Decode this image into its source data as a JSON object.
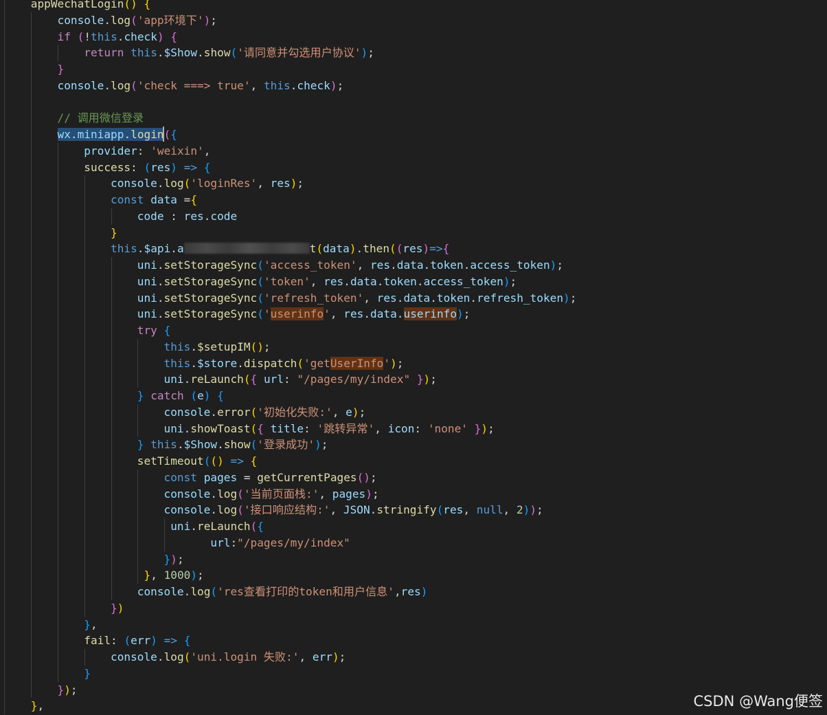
{
  "theme": {
    "background": "#1f1f1f",
    "colors": {
      "d": "#d4d4d4",
      "k": "#569cd6",
      "c": "#c586c0",
      "f": "#dcdcaa",
      "v": "#9cdcfe",
      "s": "#ce9178",
      "n": "#b5cea8",
      "m": "#6a9955",
      "y": "#ffd700",
      "p": "#da70d6",
      "b": "#179fff",
      "selection": "#264f78",
      "word_highlight": "#613214"
    }
  },
  "watermark": "CSDN @Wang便签",
  "code_lines": [
    [
      [
        "f",
        "appWechatLogin"
      ],
      [
        "y",
        "() {"
      ]
    ],
    [
      [
        "v",
        "console"
      ],
      [
        "d",
        "."
      ],
      [
        "f",
        "log"
      ],
      [
        "p",
        "("
      ],
      [
        "s",
        "'app环境下'"
      ],
      [
        "p",
        ")"
      ],
      [
        "d",
        ";"
      ]
    ],
    [
      [
        "c",
        "if"
      ],
      [
        "d",
        " "
      ],
      [
        "p",
        "("
      ],
      [
        "d",
        "!"
      ],
      [
        "k",
        "this"
      ],
      [
        "d",
        "."
      ],
      [
        "v",
        "check"
      ],
      [
        "p",
        ")"
      ],
      [
        "d",
        " "
      ],
      [
        "p",
        "{"
      ]
    ],
    [
      [
        "c",
        "return"
      ],
      [
        "d",
        " "
      ],
      [
        "k",
        "this"
      ],
      [
        "d",
        "."
      ],
      [
        "v",
        "$Show"
      ],
      [
        "d",
        "."
      ],
      [
        "f",
        "show"
      ],
      [
        "b",
        "("
      ],
      [
        "s",
        "'请同意并勾选用户协议'"
      ],
      [
        "b",
        ")"
      ],
      [
        "d",
        ";"
      ]
    ],
    [
      [
        "p",
        "}"
      ]
    ],
    [
      [
        "v",
        "console"
      ],
      [
        "d",
        "."
      ],
      [
        "f",
        "log"
      ],
      [
        "p",
        "("
      ],
      [
        "s",
        "'check ===> true'"
      ],
      [
        "d",
        ", "
      ],
      [
        "k",
        "this"
      ],
      [
        "d",
        "."
      ],
      [
        "v",
        "check"
      ],
      [
        "p",
        ")"
      ],
      [
        "d",
        ";"
      ]
    ],
    [],
    [
      [
        "m",
        "// 调用微信登录"
      ]
    ],
    [
      [
        "v",
        "wx",
        "sel"
      ],
      [
        "d",
        ".",
        "sel"
      ],
      [
        "v",
        "miniapp",
        "sel"
      ],
      [
        "d",
        ".",
        "sel"
      ],
      [
        "f",
        "login",
        "sel"
      ],
      [
        "p",
        "("
      ],
      [
        "b",
        "{"
      ]
    ],
    [
      [
        "v",
        "provider"
      ],
      [
        "d",
        ": "
      ],
      [
        "s",
        "'weixin'"
      ],
      [
        "d",
        ","
      ]
    ],
    [
      [
        "f",
        "success"
      ],
      [
        "d",
        ": "
      ],
      [
        "b",
        "("
      ],
      [
        "v",
        "res"
      ],
      [
        "b",
        ")"
      ],
      [
        "d",
        " "
      ],
      [
        "k",
        "=>"
      ],
      [
        "d",
        " "
      ],
      [
        "b",
        "{"
      ]
    ],
    [
      [
        "v",
        "console"
      ],
      [
        "d",
        "."
      ],
      [
        "f",
        "log"
      ],
      [
        "y",
        "("
      ],
      [
        "s",
        "'loginRes'"
      ],
      [
        "d",
        ", "
      ],
      [
        "v",
        "res"
      ],
      [
        "y",
        ")"
      ],
      [
        "d",
        ";"
      ]
    ],
    [
      [
        "k",
        "const"
      ],
      [
        "d",
        " "
      ],
      [
        "v",
        "data"
      ],
      [
        "d",
        " ="
      ],
      [
        "y",
        "{"
      ]
    ],
    [
      [
        "v",
        "code"
      ],
      [
        "d",
        " : "
      ],
      [
        "v",
        "res"
      ],
      [
        "d",
        "."
      ],
      [
        "v",
        "code"
      ]
    ],
    [
      [
        "y",
        "}"
      ]
    ],
    [
      [
        "k",
        "this"
      ],
      [
        "d",
        "."
      ],
      [
        "v",
        "$api"
      ],
      [
        "d",
        "."
      ],
      [
        "v",
        "a"
      ],
      [
        "blur",
        ""
      ],
      [
        "f",
        "t"
      ],
      [
        "y",
        "("
      ],
      [
        "v",
        "data"
      ],
      [
        "y",
        ")"
      ],
      [
        "d",
        "."
      ],
      [
        "f",
        "then"
      ],
      [
        "y",
        "("
      ],
      [
        "p",
        "("
      ],
      [
        "v",
        "res"
      ],
      [
        "p",
        ")"
      ],
      [
        "k",
        "=>"
      ],
      [
        "p",
        "{"
      ]
    ],
    [
      [
        "v",
        "uni"
      ],
      [
        "d",
        "."
      ],
      [
        "f",
        "setStorageSync"
      ],
      [
        "b",
        "("
      ],
      [
        "s",
        "'access_token'"
      ],
      [
        "d",
        ", "
      ],
      [
        "v",
        "res"
      ],
      [
        "d",
        "."
      ],
      [
        "v",
        "data"
      ],
      [
        "d",
        "."
      ],
      [
        "v",
        "token"
      ],
      [
        "d",
        "."
      ],
      [
        "v",
        "access_token"
      ],
      [
        "b",
        ")"
      ],
      [
        "d",
        ";"
      ]
    ],
    [
      [
        "v",
        "uni"
      ],
      [
        "d",
        "."
      ],
      [
        "f",
        "setStorageSync"
      ],
      [
        "b",
        "("
      ],
      [
        "s",
        "'token'"
      ],
      [
        "d",
        ", "
      ],
      [
        "v",
        "res"
      ],
      [
        "d",
        "."
      ],
      [
        "v",
        "data"
      ],
      [
        "d",
        "."
      ],
      [
        "v",
        "token"
      ],
      [
        "d",
        "."
      ],
      [
        "v",
        "access_token"
      ],
      [
        "b",
        ")"
      ],
      [
        "d",
        ";"
      ]
    ],
    [
      [
        "v",
        "uni"
      ],
      [
        "d",
        "."
      ],
      [
        "f",
        "setStorageSync"
      ],
      [
        "b",
        "("
      ],
      [
        "s",
        "'refresh_token'"
      ],
      [
        "d",
        ", "
      ],
      [
        "v",
        "res"
      ],
      [
        "d",
        "."
      ],
      [
        "v",
        "data"
      ],
      [
        "d",
        "."
      ],
      [
        "v",
        "token"
      ],
      [
        "d",
        "."
      ],
      [
        "v",
        "refresh_token"
      ],
      [
        "b",
        ")"
      ],
      [
        "d",
        ";"
      ]
    ],
    [
      [
        "v",
        "uni"
      ],
      [
        "d",
        "."
      ],
      [
        "f",
        "setStorageSync"
      ],
      [
        "b",
        "("
      ],
      [
        "s",
        "'"
      ],
      [
        "s",
        "userinfo",
        "hl"
      ],
      [
        "s",
        "'"
      ],
      [
        "d",
        ", "
      ],
      [
        "v",
        "res"
      ],
      [
        "d",
        "."
      ],
      [
        "v",
        "data"
      ],
      [
        "d",
        "."
      ],
      [
        "v",
        "userinfo",
        "hl"
      ],
      [
        "b",
        ")"
      ],
      [
        "d",
        ";"
      ]
    ],
    [
      [
        "c",
        "try"
      ],
      [
        "d",
        " "
      ],
      [
        "b",
        "{"
      ]
    ],
    [
      [
        "k",
        "this"
      ],
      [
        "d",
        "."
      ],
      [
        "f",
        "$setupIM"
      ],
      [
        "y",
        "()"
      ],
      [
        "d",
        ";"
      ]
    ],
    [
      [
        "k",
        "this"
      ],
      [
        "d",
        "."
      ],
      [
        "v",
        "$store"
      ],
      [
        "d",
        "."
      ],
      [
        "f",
        "dispatch"
      ],
      [
        "y",
        "("
      ],
      [
        "s",
        "'get"
      ],
      [
        "s",
        "UserInfo",
        "hl"
      ],
      [
        "s",
        "'"
      ],
      [
        "y",
        ")"
      ],
      [
        "d",
        ";"
      ]
    ],
    [
      [
        "v",
        "uni"
      ],
      [
        "d",
        "."
      ],
      [
        "f",
        "reLaunch"
      ],
      [
        "y",
        "("
      ],
      [
        "p",
        "{"
      ],
      [
        "d",
        " "
      ],
      [
        "v",
        "url"
      ],
      [
        "d",
        ": "
      ],
      [
        "s",
        "\"/pages/my/index\""
      ],
      [
        "d",
        " "
      ],
      [
        "p",
        "}"
      ],
      [
        "y",
        ")"
      ],
      [
        "d",
        ";"
      ]
    ],
    [
      [
        "b",
        "}"
      ],
      [
        "d",
        " "
      ],
      [
        "c",
        "catch"
      ],
      [
        "d",
        " "
      ],
      [
        "b",
        "("
      ],
      [
        "v",
        "e"
      ],
      [
        "b",
        ")"
      ],
      [
        "d",
        " "
      ],
      [
        "b",
        "{"
      ]
    ],
    [
      [
        "v",
        "console"
      ],
      [
        "d",
        "."
      ],
      [
        "f",
        "error"
      ],
      [
        "y",
        "("
      ],
      [
        "s",
        "'初始化失败:'"
      ],
      [
        "d",
        ", "
      ],
      [
        "v",
        "e"
      ],
      [
        "y",
        ")"
      ],
      [
        "d",
        ";"
      ]
    ],
    [
      [
        "v",
        "uni"
      ],
      [
        "d",
        "."
      ],
      [
        "f",
        "showToast"
      ],
      [
        "y",
        "("
      ],
      [
        "p",
        "{"
      ],
      [
        "d",
        " "
      ],
      [
        "v",
        "title"
      ],
      [
        "d",
        ": "
      ],
      [
        "s",
        "'跳转异常'"
      ],
      [
        "d",
        ", "
      ],
      [
        "v",
        "icon"
      ],
      [
        "d",
        ": "
      ],
      [
        "s",
        "'none'"
      ],
      [
        "d",
        " "
      ],
      [
        "p",
        "}"
      ],
      [
        "y",
        ")"
      ],
      [
        "d",
        ";"
      ]
    ],
    [
      [
        "b",
        "}"
      ],
      [
        "d",
        " "
      ],
      [
        "k",
        "this"
      ],
      [
        "d",
        "."
      ],
      [
        "v",
        "$Show"
      ],
      [
        "d",
        "."
      ],
      [
        "f",
        "show"
      ],
      [
        "b",
        "("
      ],
      [
        "s",
        "'登录成功'"
      ],
      [
        "b",
        ")"
      ],
      [
        "d",
        ";"
      ]
    ],
    [
      [
        "f",
        "setTimeout"
      ],
      [
        "b",
        "("
      ],
      [
        "y",
        "()"
      ],
      [
        "d",
        " "
      ],
      [
        "k",
        "=>"
      ],
      [
        "d",
        " "
      ],
      [
        "y",
        "{"
      ]
    ],
    [
      [
        "k",
        "const"
      ],
      [
        "d",
        " "
      ],
      [
        "v",
        "pages"
      ],
      [
        "d",
        " = "
      ],
      [
        "f",
        "getCurrentPages"
      ],
      [
        "p",
        "()"
      ],
      [
        "d",
        ";"
      ]
    ],
    [
      [
        "v",
        "console"
      ],
      [
        "d",
        "."
      ],
      [
        "f",
        "log"
      ],
      [
        "p",
        "("
      ],
      [
        "s",
        "'当前页面栈:'"
      ],
      [
        "d",
        ", "
      ],
      [
        "v",
        "pages"
      ],
      [
        "p",
        ")"
      ],
      [
        "d",
        ";"
      ]
    ],
    [
      [
        "v",
        "console"
      ],
      [
        "d",
        "."
      ],
      [
        "f",
        "log"
      ],
      [
        "p",
        "("
      ],
      [
        "s",
        "'接口响应结构:'"
      ],
      [
        "d",
        ", "
      ],
      [
        "v",
        "JSON"
      ],
      [
        "d",
        "."
      ],
      [
        "f",
        "stringify"
      ],
      [
        "b",
        "("
      ],
      [
        "v",
        "res"
      ],
      [
        "d",
        ", "
      ],
      [
        "k",
        "null"
      ],
      [
        "d",
        ", "
      ],
      [
        "n",
        "2"
      ],
      [
        "b",
        ")"
      ],
      [
        "p",
        ")"
      ],
      [
        "d",
        ";"
      ]
    ],
    [
      [
        "v",
        "uni"
      ],
      [
        "d",
        "."
      ],
      [
        "f",
        "reLaunch"
      ],
      [
        "p",
        "("
      ],
      [
        "b",
        "{"
      ]
    ],
    [
      [
        "v",
        "url"
      ],
      [
        "d",
        ":"
      ],
      [
        "s",
        "\"/pages/my/index\""
      ]
    ],
    [
      [
        "b",
        "}"
      ],
      [
        "p",
        ")"
      ],
      [
        "d",
        ";"
      ]
    ],
    [
      [
        "y",
        "}"
      ],
      [
        "d",
        ", "
      ],
      [
        "n",
        "1000"
      ],
      [
        "b",
        ")"
      ],
      [
        "d",
        ";"
      ]
    ],
    [
      [
        "v",
        "console"
      ],
      [
        "d",
        "."
      ],
      [
        "f",
        "log"
      ],
      [
        "b",
        "("
      ],
      [
        "s",
        "'res查看打印的token和用户信息'"
      ],
      [
        "d",
        ","
      ],
      [
        "v",
        "res"
      ],
      [
        "b",
        ")"
      ]
    ],
    [
      [
        "p",
        "}"
      ],
      [
        "y",
        ")"
      ]
    ],
    [
      [
        "b",
        "}"
      ],
      [
        "d",
        ","
      ]
    ],
    [
      [
        "f",
        "fail"
      ],
      [
        "d",
        ": "
      ],
      [
        "b",
        "("
      ],
      [
        "v",
        "err"
      ],
      [
        "b",
        ")"
      ],
      [
        "d",
        " "
      ],
      [
        "k",
        "=>"
      ],
      [
        "d",
        " "
      ],
      [
        "b",
        "{"
      ]
    ],
    [
      [
        "v",
        "console"
      ],
      [
        "d",
        "."
      ],
      [
        "f",
        "log"
      ],
      [
        "y",
        "("
      ],
      [
        "s",
        "'uni.login 失败:'"
      ],
      [
        "d",
        ", "
      ],
      [
        "v",
        "err"
      ],
      [
        "y",
        ")"
      ],
      [
        "d",
        ";"
      ]
    ],
    [
      [
        "b",
        "}"
      ]
    ],
    [
      [
        "p",
        "}"
      ],
      [
        "y",
        ")"
      ],
      [
        "d",
        ";"
      ]
    ],
    [
      [
        "y",
        "}"
      ],
      [
        "d",
        ","
      ]
    ]
  ]
}
